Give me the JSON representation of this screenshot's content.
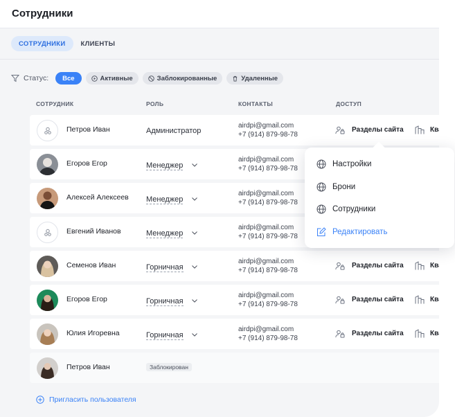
{
  "header": {
    "title": "Сотрудники"
  },
  "tabs": [
    {
      "label": "СОТРУДНИКИ",
      "active": true
    },
    {
      "label": "КЛИЕНТЫ",
      "active": false
    }
  ],
  "filters": {
    "label": "Статус:",
    "chips": [
      {
        "label": "Все",
        "active": true,
        "icon": ""
      },
      {
        "label": "Активные",
        "active": false,
        "icon": "play-circle-icon"
      },
      {
        "label": "Заблокированные",
        "active": false,
        "icon": "block-icon"
      },
      {
        "label": "Удаленные",
        "active": false,
        "icon": "trash-icon"
      }
    ]
  },
  "table": {
    "columns": [
      "СОТРУДНИК",
      "РОЛЬ",
      "КОНТАКТЫ",
      "ДОСТУП"
    ],
    "rows": [
      {
        "name": "Петров Иван",
        "role": "Администратор",
        "email": "airdpi@gmail.com",
        "phone": "+7 (914) 879-98-78",
        "access": "Разделы сайта",
        "access2": "Ква",
        "avatar": "placeholder"
      },
      {
        "name": "Егоров Егор",
        "role": "Менеджер",
        "email": "airdpi@gmail.com",
        "phone": "+7 (914) 879-98-78",
        "access": "",
        "access2": "",
        "avatar": "photo"
      },
      {
        "name": "Алексей Алексеев",
        "role": "Менеджер",
        "email": "airdpi@gmail.com",
        "phone": "+7 (914) 879-98-78",
        "access": "",
        "access2": "",
        "avatar": "photo"
      },
      {
        "name": "Евгений Иванов",
        "role": "Менеджер",
        "email": "airdpi@gmail.com",
        "phone": "+7 (914) 879-98-78",
        "access": "",
        "access2": "",
        "avatar": "placeholder"
      },
      {
        "name": "Семенов Иван",
        "role": "Горничная",
        "email": "airdpi@gmail.com",
        "phone": "+7 (914) 879-98-78",
        "access": "Разделы сайта",
        "access2": "Ква",
        "avatar": "photo"
      },
      {
        "name": "Егоров Егор",
        "role": "Горничная",
        "email": "airdpi@gmail.com",
        "phone": "+7 (914) 879-98-78",
        "access": "Разделы сайта",
        "access2": "Ква",
        "avatar": "photo"
      },
      {
        "name": "Юлия Игоревна",
        "role": "Горничная",
        "email": "airdpi@gmail.com",
        "phone": "+7 (914) 879-98-78",
        "access": "Разделы сайта",
        "access2": "Ква",
        "avatar": "photo"
      },
      {
        "name": "Петров Иван",
        "role": "",
        "status": "Заблокирован",
        "email": "",
        "phone": "",
        "access": "",
        "access2": "",
        "avatar": "photo"
      }
    ]
  },
  "invite": {
    "label": "Пригласить пользователя"
  },
  "popup": {
    "items": [
      {
        "label": "Настройки",
        "icon": "globe-icon"
      },
      {
        "label": "Брони",
        "icon": "globe-icon"
      },
      {
        "label": "Сотрудники",
        "icon": "globe-icon"
      },
      {
        "label": "Редактировать",
        "icon": "edit-icon"
      }
    ]
  },
  "colors": {
    "accent": "#3a82f7",
    "tab_active_bg": "#dde9fb",
    "background": "#f4f5f7"
  }
}
